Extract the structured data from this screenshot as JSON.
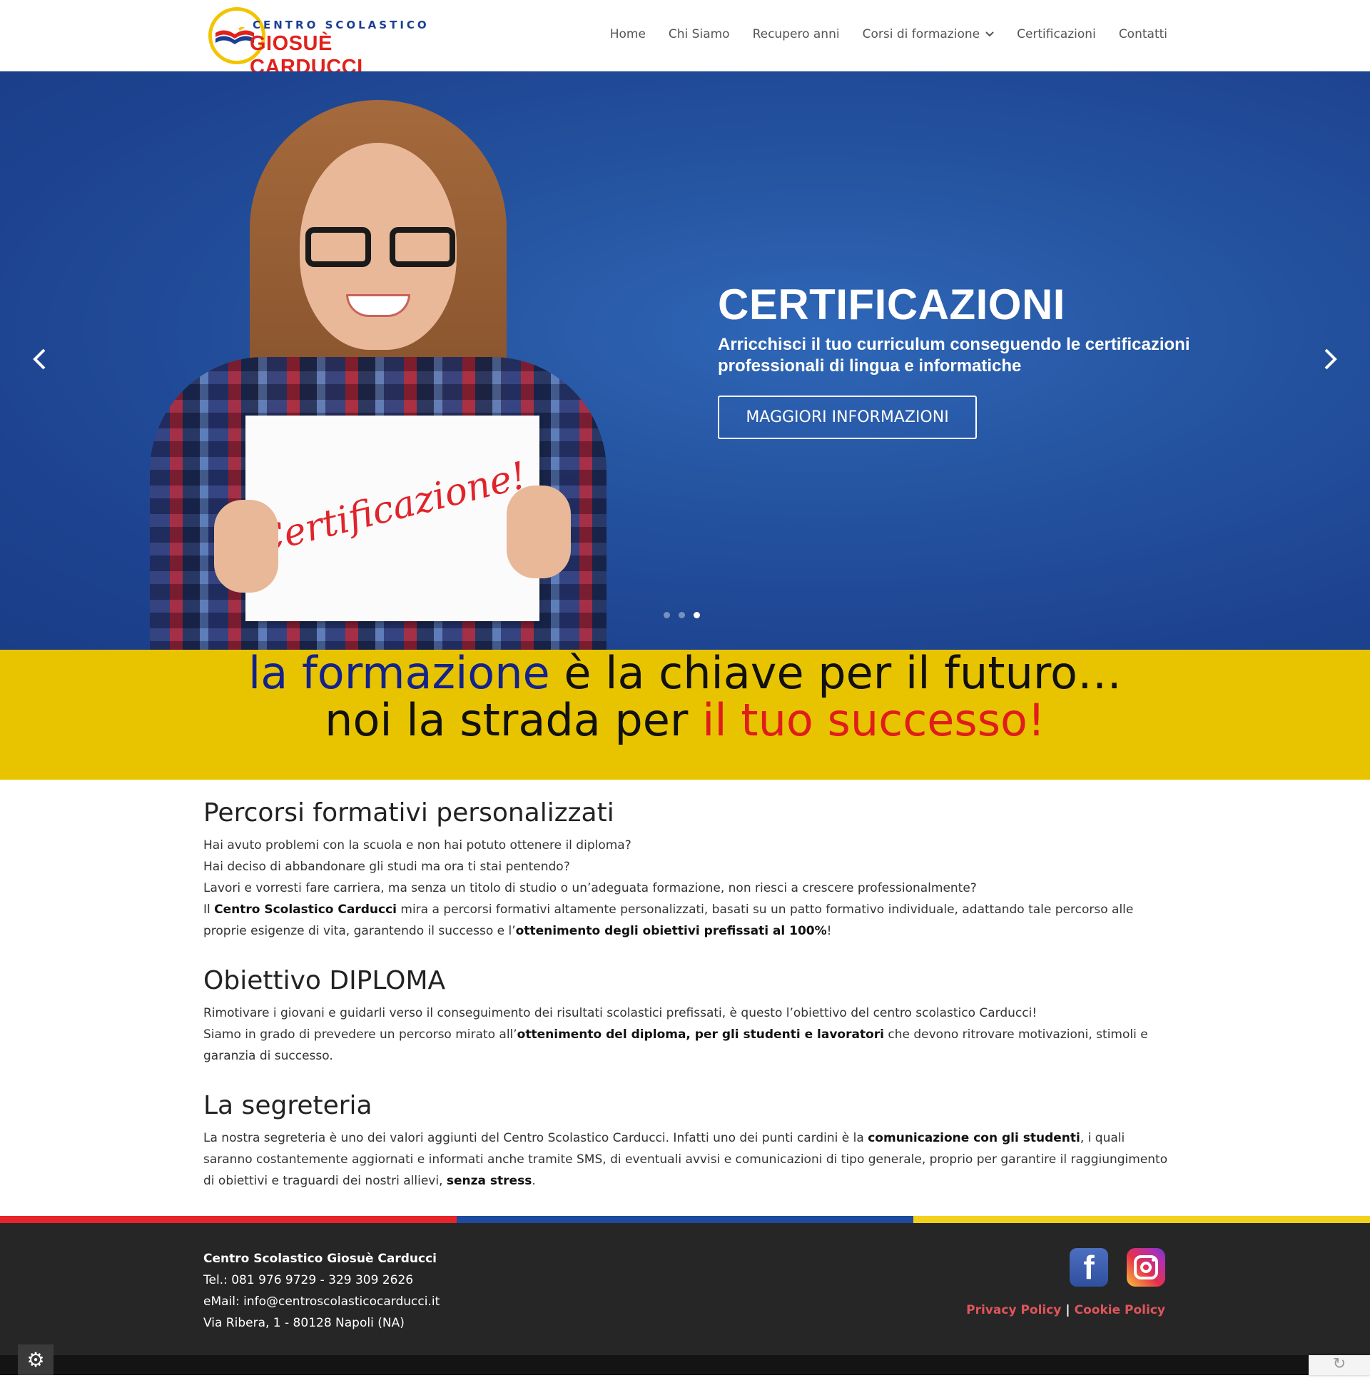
{
  "logo": {
    "line1": "CENTRO SCOLASTICO",
    "line2": "GIOSUÈ CARDUCCI"
  },
  "nav": {
    "items": [
      {
        "label": "Home"
      },
      {
        "label": "Chi Siamo"
      },
      {
        "label": "Recupero anni"
      },
      {
        "label": "Corsi di formazione"
      },
      {
        "label": "Certificazioni"
      },
      {
        "label": "Contatti"
      }
    ]
  },
  "hero": {
    "title": "CERTIFICAZIONI",
    "subtitle": "Arricchisci il tuo curriculum conseguendo le certificazioni professionali di lingua e informatiche",
    "button": "MAGGIORI INFORMAZIONI",
    "sign_text": "Certificazione!",
    "arrow_left": "‹",
    "arrow_right": "›",
    "slide_count": 3,
    "active_slide": 3
  },
  "banner": {
    "line1_part1": "la formazione",
    "line1_part2": " è la chiave per il futuro…",
    "line2_part1": "noi la strada per ",
    "line2_part2": "il tuo successo!"
  },
  "sections": {
    "s1": {
      "title": "Percorsi formativi personalizzati",
      "p1": "Hai avuto problemi con la scuola e non hai potuto ottenere il diploma?",
      "p2": "Hai deciso di abbandonare gli studi ma ora ti stai pentendo?",
      "p3": "Lavori e vorresti fare carriera, ma senza un titolo di studio o un’adeguata formazione, non riesci a crescere professionalmente?",
      "p4a": "Il ",
      "p4b": "Centro Scolastico Carducci",
      "p4c": " mira a percorsi formativi altamente personalizzati, basati su un patto formativo individuale, adattando tale percorso alle proprie esigenze di vita, garantendo il successo e l’",
      "p4d": "ottenimento degli obiettivi prefissati al 100%",
      "p4e": "!"
    },
    "s2": {
      "title": "Obiettivo DIPLOMA",
      "p1": "Rimotivare i giovani e guidarli verso il conseguimento dei risultati scolastici prefissati, è questo l’obiettivo del centro scolastico Carducci!",
      "p2a": "Siamo in grado di prevedere un percorso mirato all’",
      "p2b": "ottenimento del diploma, per gli studenti e lavoratori",
      "p2c": " che devono ritrovare motivazioni, stimoli e garanzia di successo."
    },
    "s3": {
      "title": "La segreteria",
      "p1a": "La nostra segreteria è uno dei valori aggiunti del Centro Scolastico Carducci. Infatti uno dei punti cardini è la ",
      "p1b": "comunicazione con gli studenti",
      "p1c": ", i quali saranno costantemente aggiornati e informati anche tramite SMS, di eventuali avvisi e comunicazioni di tipo generale, proprio per garantire il raggiungimento di obiettivi e traguardi dei nostri allievi, ",
      "p1d": "senza stress",
      "p1e": "."
    }
  },
  "footer": {
    "name": "Centro Scolastico Giosuè Carducci",
    "tel": "Tel.: 081 976 9729 - 329 309 2626",
    "email": "eMail: info@centroscolasticocarducci.it",
    "address": "Via Ribera, 1 - 80128 Napoli (NA)",
    "privacy": "Privacy Policy",
    "separator": "|",
    "cookie": "Cookie Policy",
    "fb_glyph": "f",
    "gear_glyph": "⚙",
    "recaptcha_glyph": "↻"
  },
  "colors": {
    "hero_blue": "#24529e",
    "banner_yellow": "#e8c400",
    "brand_red": "#e01d1d",
    "brand_blue": "#14228c",
    "tricolor": [
      "#e5252a",
      "#1e4aa0",
      "#f2d01b"
    ],
    "footer_bg": "#262626",
    "policy_link": "#e0555a"
  },
  "icons": {
    "nav_dropdown": "chevron-down-icon",
    "facebook": "facebook-icon",
    "instagram": "instagram-icon",
    "settings": "gear-icon",
    "prev": "chevron-left-icon",
    "next": "chevron-right-icon"
  }
}
